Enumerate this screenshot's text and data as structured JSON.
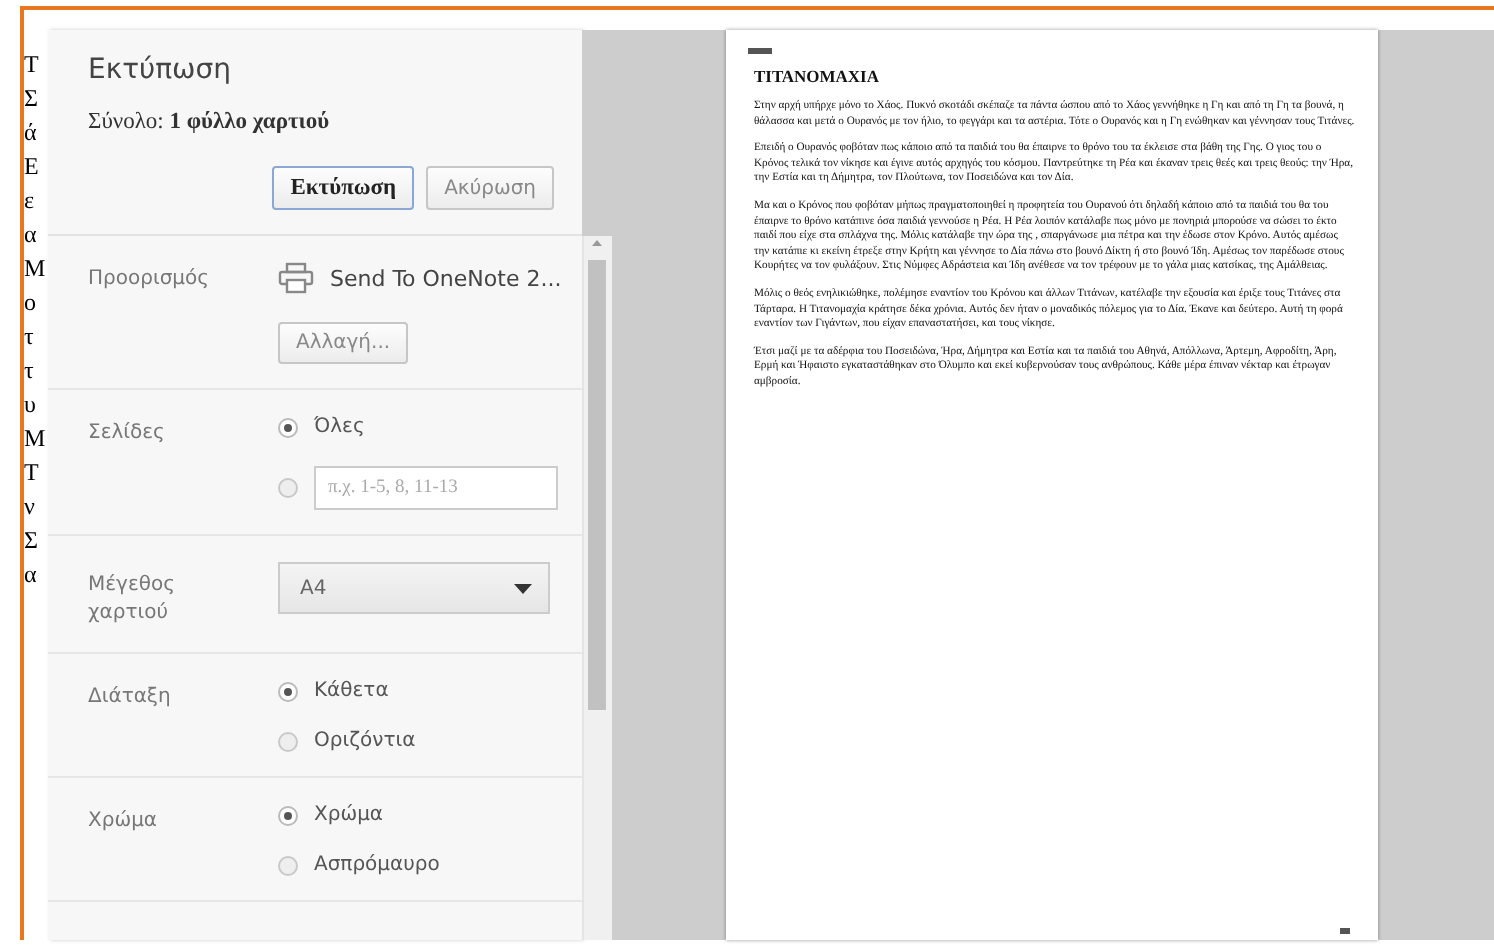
{
  "background_fragments": [
    "Τ",
    "Σ",
    "ά",
    "Ε",
    "ε",
    "α",
    "Μ",
    "ο",
    "τ",
    "τ",
    "υ",
    "Μ",
    "Τ",
    "ν",
    "Σ",
    "α"
  ],
  "dialog": {
    "title": "Εκτύπωση",
    "total": "Σύνολο: **1 φύλλο χαρτιού**",
    "buttons": [
      {
        "label": "Εκτύπωση",
        "kind": "primary"
      },
      {
        "label": "Ακύρωση",
        "kind": "secondary"
      }
    ],
    "settings": [
      {
        "kind": "destination",
        "label": "Προορισμός",
        "printer": "Send To OneNote 2...",
        "button": "Αλλαγή..."
      },
      {
        "kind": "radio",
        "label": "Σελίδες",
        "options": [
          {
            "label": "Όλες",
            "selected": true
          },
          {
            "placeholder": "π.χ. 1-5, 8, 11-13",
            "selected": false
          }
        ]
      },
      {
        "kind": "select",
        "label": "Μέγεθος χαρτιού",
        "value": "A4"
      },
      {
        "kind": "radio",
        "label": "Διάταξη",
        "options": [
          {
            "label": "Κάθετα",
            "selected": true
          },
          {
            "label": "Οριζόντια",
            "selected": false
          }
        ]
      },
      {
        "kind": "radio",
        "label": "Χρώμα",
        "options": [
          {
            "label": "Χρώμα",
            "selected": true
          },
          {
            "label": "Ασπρόμαυρο",
            "selected": false
          }
        ]
      }
    ]
  },
  "preview": {
    "title": "ΤΙΤΑΝΟΜΑΧΙΑ",
    "paragraphs": [
      "Στην αρχή υπήρχε μόνο το Χάος. Πυκνό σκοτάδι σκέπαζε τα πάντα ώσπου από το Χάος γεννήθηκε η Γη και από τη Γη τα βουνά, η θάλασσα και μετά ο Ουρανός με τον ήλιο, το φεγγάρι και τα αστέρια. Τότε ο Ουρανός και η Γη ενώθηκαν και γέννησαν τους Τιτάνες.",
      "Επειδή ο Ουρανός φοβόταν πως κάποιο από τα παιδιά του θα έπαιρνε το θρόνο του τα έκλεισε στα βάθη της Γης. Ο γιος του ο Κρόνος τελικά τον νίκησε και έγινε αυτός αρχηγός του κόσμου. Παντρεύτηκε τη Ρέα και έκαναν τρεις θεές και τρεις θεούς: την Ήρα, την Εστία και τη Δήμητρα, τον Πλούτωνα, τον Ποσειδώνα και τον Δία.",
      "Μα και ο Κρόνος που φοβόταν μήπως πραγματοποιηθεί η προφητεία του Ουρανού ότι δηλαδή κάποιο από τα παιδιά του θα του έπαιρνε το θρόνο κατάπινε όσα παιδιά γεννούσε η Ρέα. Η Ρέα λοιπόν κατάλαβε πως μόνο με πονηριά μπορούσε να σώσει το έκτο παιδί που είχε στα σπλάχνα της. Μόλις κατάλαβε την ώρα της , σπαργάνωσε μια πέτρα και την έδωσε στον Κρόνο. Αυτός αμέσως την κατάπιε κι εκείνη έτρεξε στην Κρήτη και γέννησε το Δία πάνω στο βουνό Δίκτη ή στο βουνό Ίδη. Αμέσως τον παρέδωσε στους Κουρήτες να τον φυλάξουν. Στις Νύμφες Αδράστεια και Ίδη ανέθεσε να τον τρέφουν με το γάλα μιας κατσίκας, της Αμάλθειας.",
      "Μόλις ο θεός ενηλικιώθηκε, πολέμησε εναντίον του Κρόνου και άλλων Τιτάνων, κατέλαβε την εξουσία και έριξε τους Τιτάνες στα Τάρταρα. Η Τιτανομαχία κράτησε δέκα χρόνια. Αυτός δεν ήταν ο μοναδικός πόλεμος για το Δία. Έκανε και δεύτερο. Αυτή τη φορά εναντίον των Γιγάντων, που είχαν επαναστατήσει, και τους νίκησε.",
      "Έτσι μαζί με τα αδέρφια του Ποσειδώνα, Ήρα, Δήμητρα και Εστία και τα παιδιά του Αθηνά, Απόλλωνα, Άρτεμη, Αφροδίτη, Άρη, Ερμή και Ήφαιστο εγκαταστάθηκαν στο Όλυμπο και εκεί κυβερνούσαν τους ανθρώπους. Κάθε μέρα έπιναν νέκταρ και έτρωγαν αμβροσία."
    ]
  }
}
